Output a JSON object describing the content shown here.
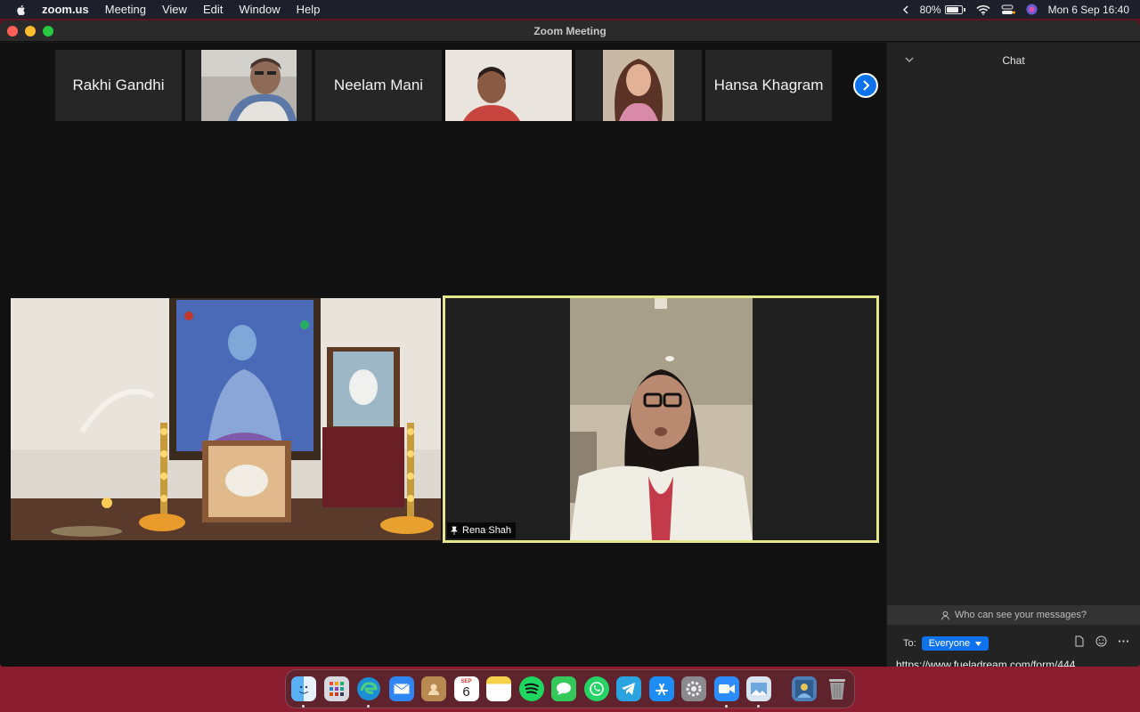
{
  "menubar": {
    "app_name": "zoom.us",
    "menus": [
      "Meeting",
      "View",
      "Edit",
      "Window",
      "Help"
    ],
    "battery_percent": "80%",
    "battery_level": 0.8,
    "date_time": "Mon 6 Sep  16:40"
  },
  "window": {
    "title": "Zoom Meeting"
  },
  "filmstrip": {
    "participants": [
      {
        "name": "Rakhi Gandhi",
        "video": false
      },
      {
        "name": "",
        "video": true
      },
      {
        "name": "Neelam Mani",
        "video": false
      },
      {
        "name": "",
        "video": true
      },
      {
        "name": "",
        "video": true
      },
      {
        "name": "Hansa Khagram",
        "video": false
      }
    ]
  },
  "speaker": {
    "name": "Rena Shah",
    "highlight_color": "#e6e68a"
  },
  "chat": {
    "title": "Chat",
    "who_can_see": "Who can see your messages?",
    "to_label": "To:",
    "recipient": "Everyone",
    "draft_message": "https://www.fueladream.com/form/444"
  },
  "dock": {
    "calendar_month": "SEP",
    "calendar_day": "6",
    "apps": [
      "finder-icon",
      "launchpad-icon",
      "edge-icon",
      "mail-icon",
      "contacts-icon",
      "calendar-icon",
      "notes-icon",
      "spotify-icon",
      "messages-icon",
      "whatsapp-icon",
      "telegram-icon",
      "app-store-icon",
      "system-preferences-icon",
      "zoom-icon",
      "preview-icon",
      "image-stack-icon",
      "trash-icon"
    ]
  },
  "colors": {
    "zoom_blue": "#0e72ed",
    "active_speaker": "#e6e68a"
  }
}
